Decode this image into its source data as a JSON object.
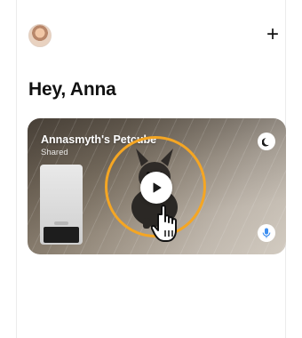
{
  "header": {
    "avatar_icon": "user-avatar",
    "add_label": "+"
  },
  "greeting": "Hey, Anna",
  "camera_card": {
    "name": "Annasmyth's Petcube",
    "status": "Shared",
    "night_mode_icon": "moon-icon",
    "mic_icon": "microphone-icon",
    "play_icon": "play-icon",
    "accent_color": "#f5a623"
  }
}
